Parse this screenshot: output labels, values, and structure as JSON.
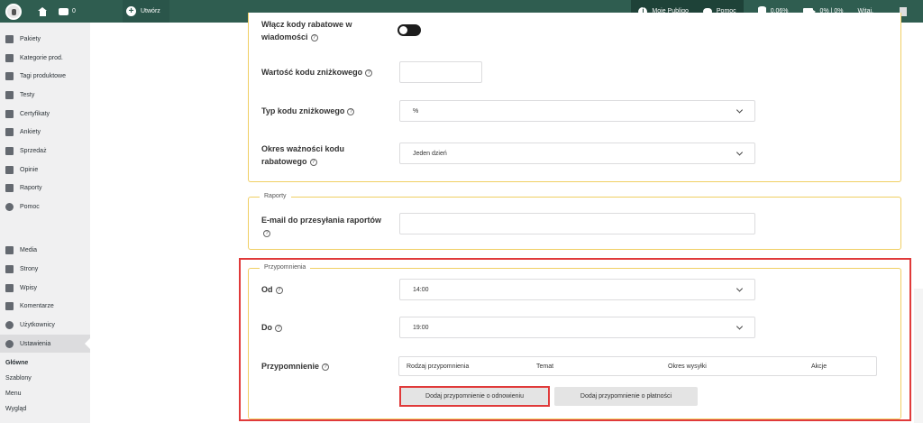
{
  "topbar": {
    "comment_count": "0",
    "new_label": "Utwórz",
    "my_account": "Moje Publigo",
    "help": "Pomoc",
    "storage": "0.06%",
    "video": "0% | 0%",
    "greeting": "Witaj,"
  },
  "sidebar": {
    "items": [
      {
        "label": "Pakiety",
        "icon": "grid-icon"
      },
      {
        "label": "Kategorie prod.",
        "icon": "folder-icon"
      },
      {
        "label": "Tagi produktowe",
        "icon": "tag-icon"
      },
      {
        "label": "Testy",
        "icon": "pencil-icon"
      },
      {
        "label": "Certyfikaty",
        "icon": "certificate-icon"
      },
      {
        "label": "Ankiety",
        "icon": "survey-icon"
      },
      {
        "label": "Sprzedaż",
        "icon": "cart-icon"
      },
      {
        "label": "Opinie",
        "icon": "opinion-icon"
      },
      {
        "label": "Raporty",
        "icon": "chart-icon"
      },
      {
        "label": "Pomoc",
        "icon": "help-icon"
      },
      {
        "label": "Media",
        "icon": "media-icon"
      },
      {
        "label": "Strony",
        "icon": "page-icon"
      },
      {
        "label": "Wpisy",
        "icon": "pin-icon"
      },
      {
        "label": "Komentarze",
        "icon": "comment-icon"
      },
      {
        "label": "Użytkownicy",
        "icon": "user-icon"
      },
      {
        "label": "Ustawienia",
        "icon": "settings-icon"
      }
    ],
    "subitems": [
      "Główne",
      "Szablony",
      "Menu",
      "Wygląd"
    ]
  },
  "discount": {
    "toggle_label_line1": "Włącz kody rabatowe w",
    "toggle_label_line2": "wiadomości",
    "value_label": "Wartość kodu zniżkowego",
    "value": "",
    "type_label": "Typ kodu zniżkowego",
    "type_value": "%",
    "validity_label_line1": "Okres ważności kodu",
    "validity_label_line2": "rabatowego",
    "validity_value": "Jeden dzień"
  },
  "reports": {
    "legend": "Raporty",
    "email_label": "E-mail do przesyłania raportów",
    "email_value": ""
  },
  "reminders": {
    "legend": "Przypomnienia",
    "from_label": "Od",
    "from_value": "14:00",
    "to_label": "Do",
    "to_value": "19:00",
    "reminder_label": "Przypomnienie",
    "columns": [
      "Rodzaj przypomnienia",
      "Temat",
      "Okres wysyłki",
      "Akcje"
    ],
    "add_renewal_button": "Dodaj przypomnienie o odnowieniu",
    "add_payment_button": "Dodaj przypomnienie o płatności"
  },
  "colors": {
    "admin_bar": "#2f5d50",
    "panel_border": "#f0cf63",
    "highlight": "#e03a3a"
  }
}
